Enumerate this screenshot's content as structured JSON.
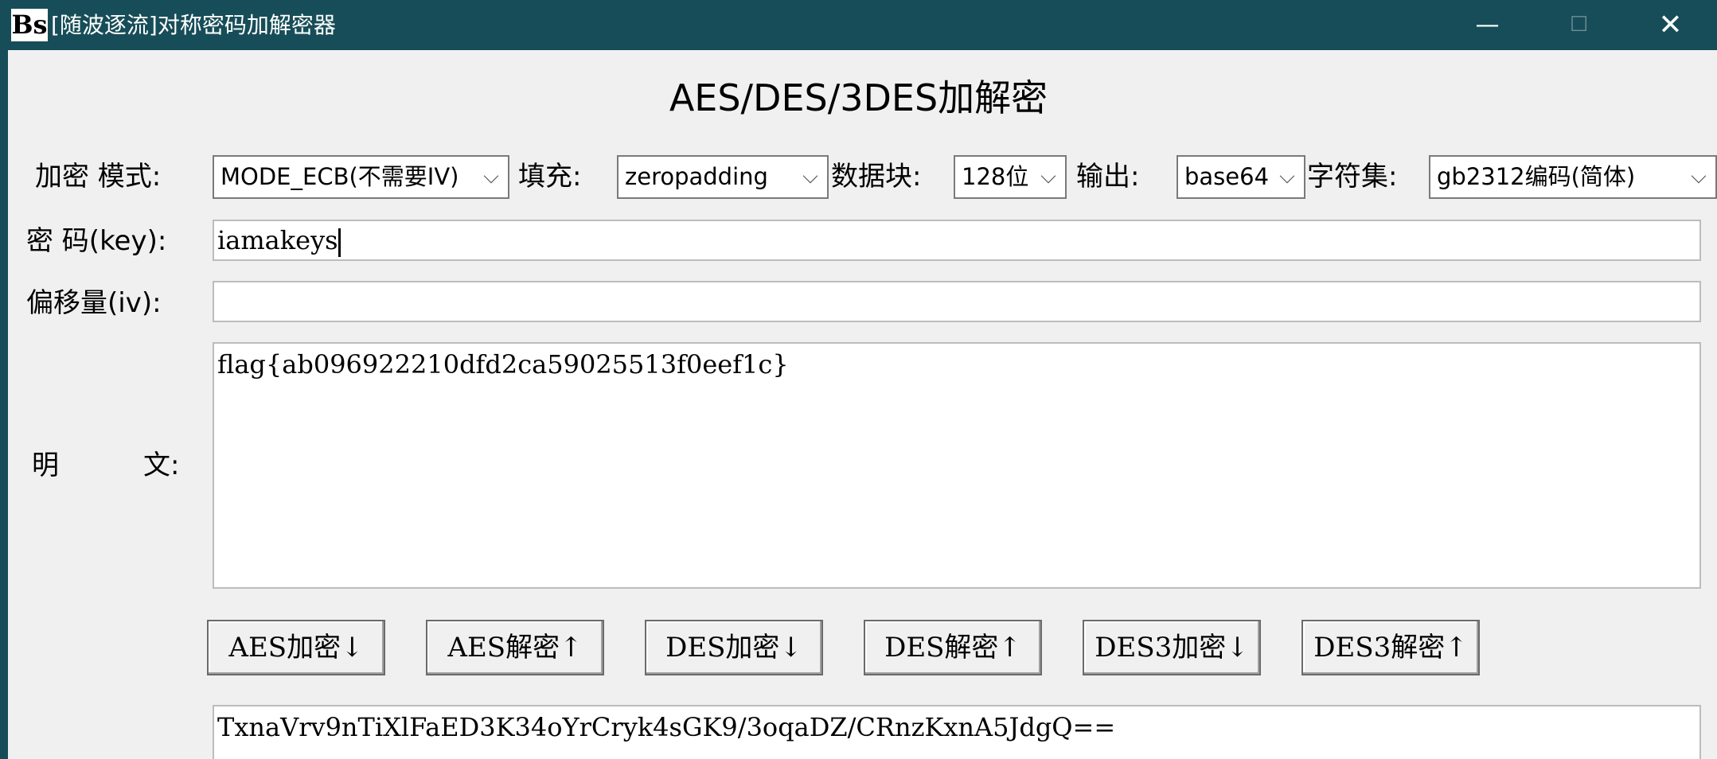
{
  "window": {
    "title": "[随波逐流]对称密码加解密器",
    "icon": "Bs",
    "minimize_glyph": "—",
    "maximize_glyph": "☐",
    "close_glyph": "✕"
  },
  "heading": "AES/DES/3DES加解密",
  "options": {
    "mode_label": "加密 模式:",
    "mode_value": "MODE_ECB(不需要IV)",
    "padding_label": "填充:",
    "padding_value": "zeropadding",
    "block_label": "数据块:",
    "block_value": "128位",
    "output_label": "输出:",
    "output_value": "base64",
    "charset_label": "字符集:",
    "charset_value": "gb2312编码(简体)"
  },
  "key": {
    "label": "密 码(key):",
    "value": "iamakeys"
  },
  "iv": {
    "label": "偏移量(iv):",
    "value": ""
  },
  "plaintext": {
    "label_left": "明",
    "label_right": "文:",
    "value": "flag{ab096922210dfd2ca59025513f0eef1c}"
  },
  "buttons": {
    "aes_encrypt": "AES加密↓",
    "aes_decrypt": "AES解密↑",
    "des_encrypt": "DES加密↓",
    "des_decrypt": "DES解密↑",
    "des3_encrypt": "DES3加密↓",
    "des3_decrypt": "DES3解密↑"
  },
  "ciphertext": {
    "value": "TxnaVrv9nTiXlFaED3K34oYrCryk4sGK9/3oqaDZ/CRnzKxnA5JdgQ=="
  },
  "colors": {
    "titlebar": "#174d58",
    "background": "#f0f0f0"
  }
}
